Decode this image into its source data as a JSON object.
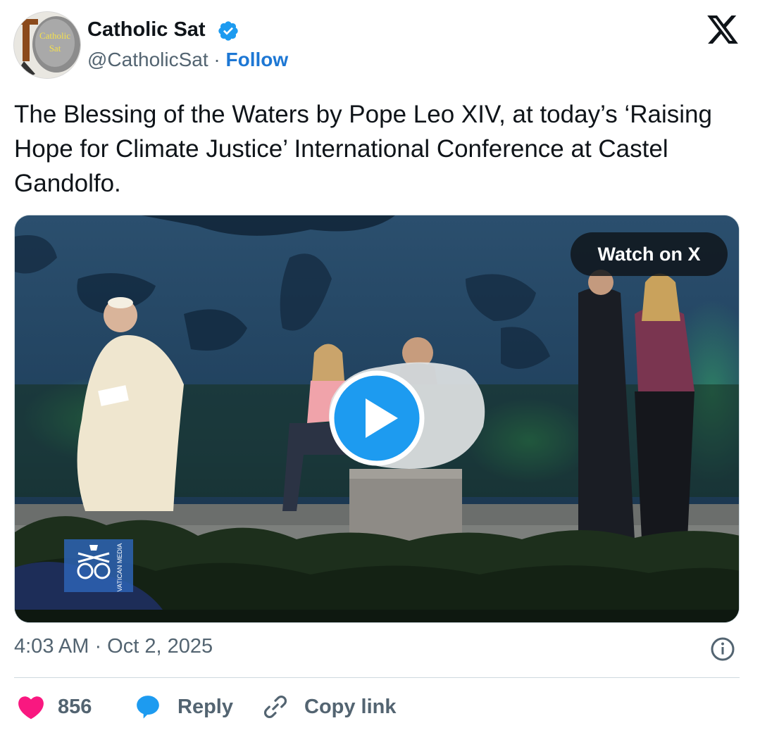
{
  "author": {
    "name": "Catholic Sat",
    "handle": "@CatholicSat",
    "separator": "·",
    "follow_label": "Follow",
    "avatar_text_line1": "Catholic",
    "avatar_text_line2": "Sat",
    "verified": true
  },
  "tweet": {
    "text": "The Blessing of the Waters by Pope Leo XIV, at today’s ‘Raising Hope for Climate Justice’ International Conference at Castel Gandolfo."
  },
  "media": {
    "watch_label": "Watch on X",
    "watermark_text": "VATICAN MEDIA"
  },
  "meta": {
    "timestamp": "4:03 AM · Oct 2, 2025"
  },
  "actions": {
    "like_count": "856",
    "reply_label": "Reply",
    "copy_label": "Copy link"
  },
  "colors": {
    "accent": "#1d9bf0",
    "follow": "#1d77d4",
    "like": "#f91880",
    "muted": "#536471"
  }
}
